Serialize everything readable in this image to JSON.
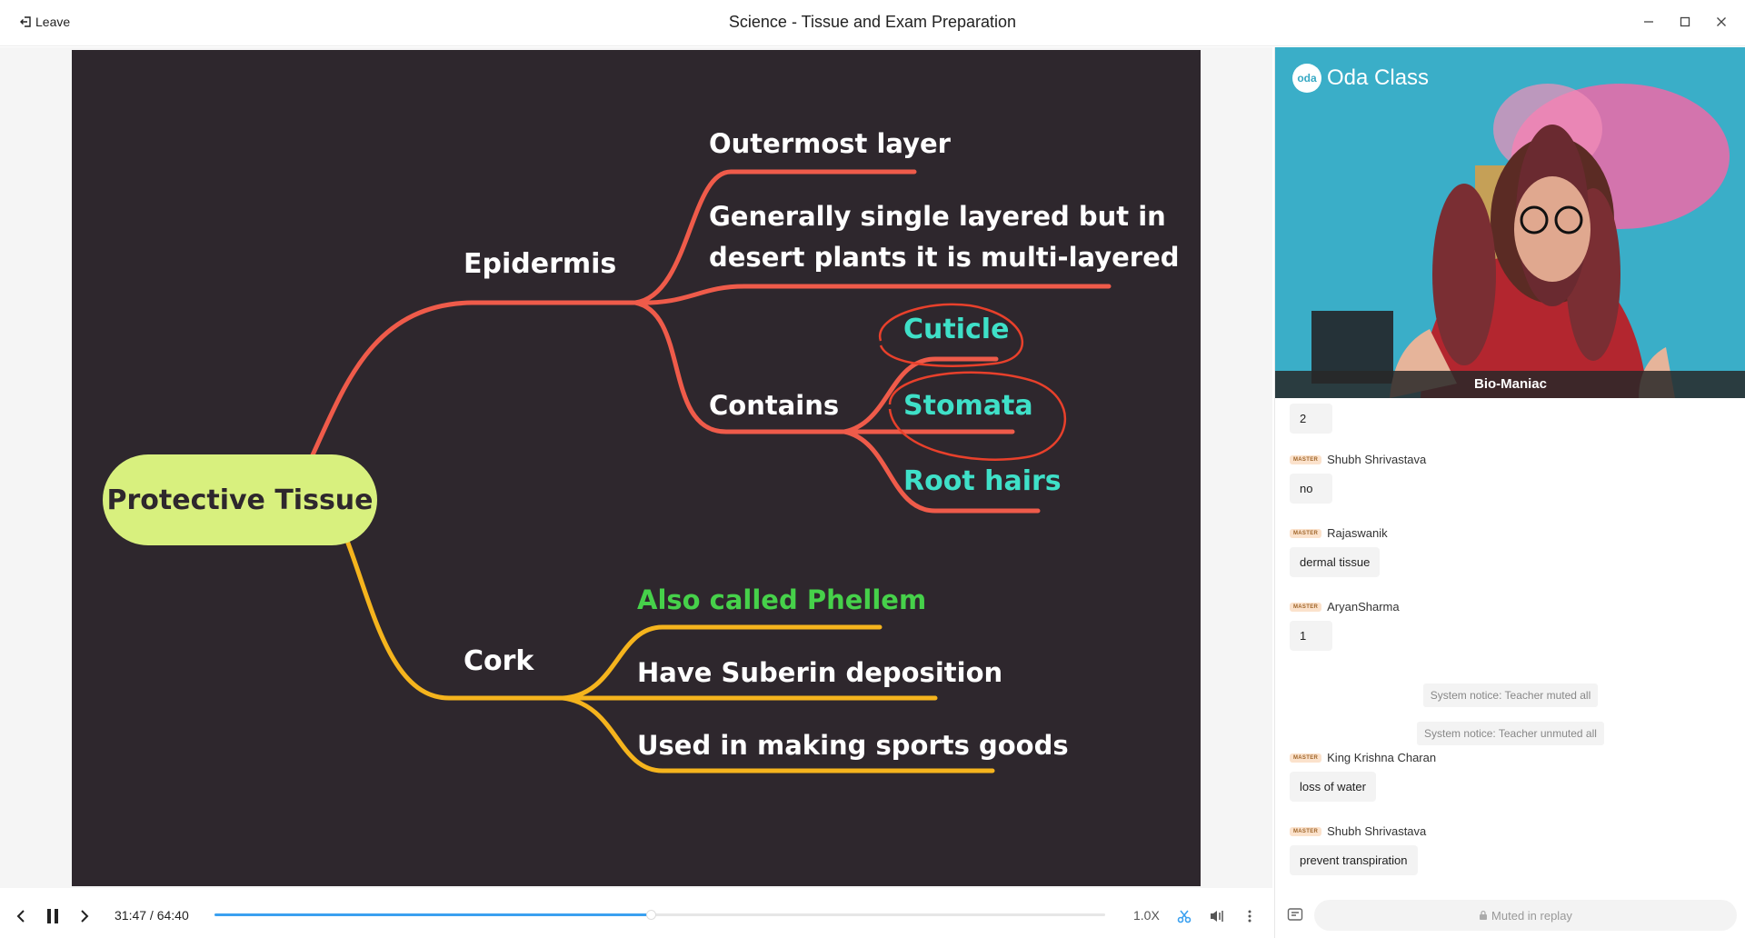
{
  "window": {
    "title": "Science - Tissue and Exam Preparation",
    "leave_label": "Leave"
  },
  "slide": {
    "root": "Protective Tissue",
    "branch1": "Epidermis",
    "outermost": "Outermost layer",
    "single_line1": "Generally single layered but in",
    "single_line2": "desert plants it is multi-layered",
    "contains": "Contains",
    "cuticle": "Cuticle",
    "stomata": "Stomata",
    "root_hairs": "Root hairs",
    "branch2": "Cork",
    "phellem": "Also called Phellem",
    "suberin": "Have Suberin deposition",
    "sports": "Used in making sports goods"
  },
  "player": {
    "time": "31:47 / 64:40",
    "progress": 0.49,
    "speed": "1.0X"
  },
  "video": {
    "logo_text": "Oda Class",
    "teacher_name": "Bio-Maniac"
  },
  "chat": {
    "badge": "MASTER",
    "messages": [
      {
        "sender": "",
        "text": "2"
      },
      {
        "sender": "Shubh Shrivastava",
        "text": "no"
      },
      {
        "sender": "Rajaswanik",
        "text": "dermal tissue"
      },
      {
        "sender": "AryanSharma",
        "text": "1"
      },
      {
        "sender": "King Krishna Charan",
        "text": "loss of water"
      },
      {
        "sender": "Shubh Shrivastava",
        "text": "prevent transpiration"
      }
    ],
    "notices": [
      "System notice: Teacher muted all",
      "System notice: Teacher unmuted all"
    ],
    "input_label": "Muted in replay"
  },
  "colors": {
    "accent": "#3aa0f0",
    "slide_bg": "#2e272d",
    "root_node": "#d8f07e",
    "red_branch": "#ef5b4a",
    "yellow_branch": "#f5b41d",
    "teal_text": "#3fe0c8",
    "green_text": "#46d14a",
    "annotation": "#e8402b"
  },
  "icons": [
    "leave-icon",
    "minimize-icon",
    "maximize-icon",
    "close-icon",
    "previous-icon",
    "pause-icon",
    "next-icon",
    "scissors-icon",
    "volume-icon",
    "more-icon",
    "lock-icon",
    "chat-toggle-icon"
  ]
}
